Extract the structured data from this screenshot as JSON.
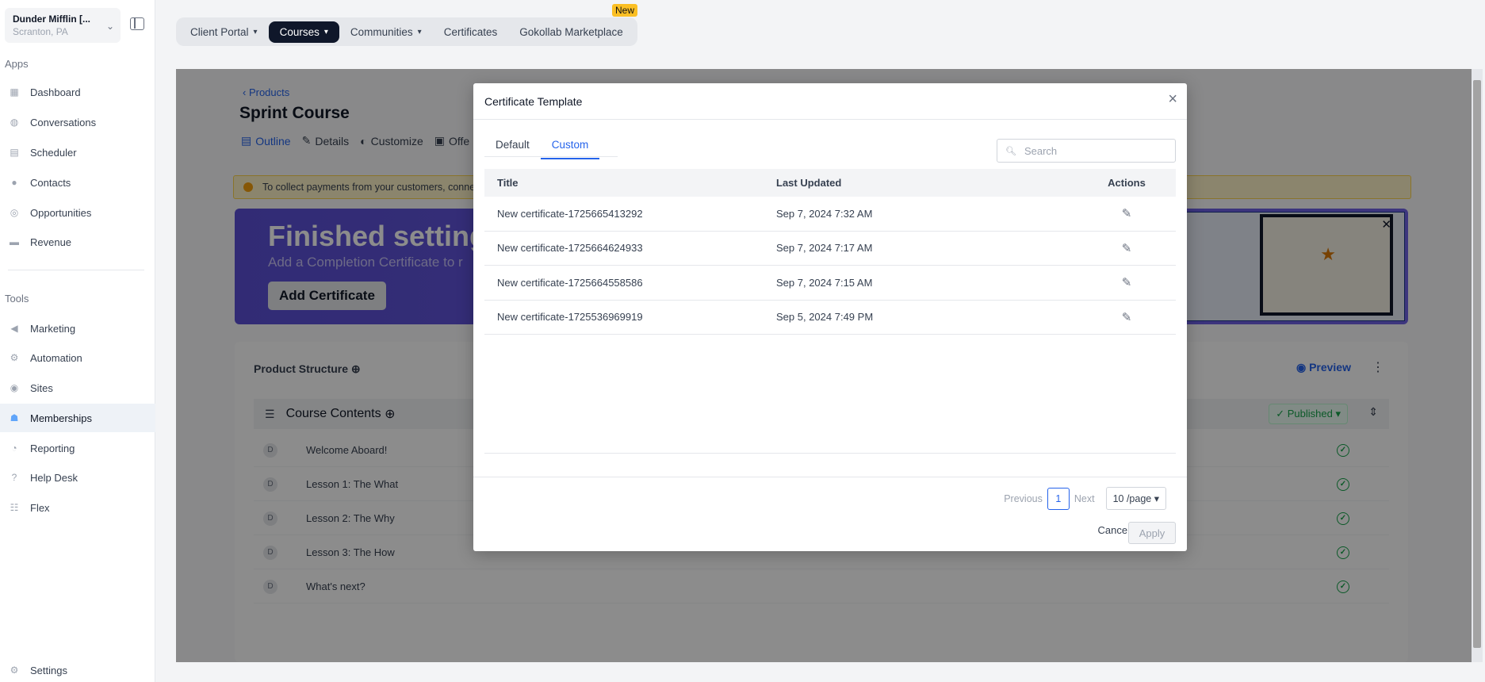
{
  "account": {
    "name": "Dunder Mifflin [...",
    "location": "Scranton, PA"
  },
  "sidebar": {
    "apps_label": "Apps",
    "apps": [
      {
        "label": "Dashboard",
        "icon": "dashboard-icon"
      },
      {
        "label": "Conversations",
        "icon": "chat-icon"
      },
      {
        "label": "Scheduler",
        "icon": "calendar-icon"
      },
      {
        "label": "Contacts",
        "icon": "user-icon"
      },
      {
        "label": "Opportunities",
        "icon": "target-icon"
      },
      {
        "label": "Revenue",
        "icon": "card-icon"
      }
    ],
    "tools_label": "Tools",
    "tools": [
      {
        "label": "Marketing",
        "icon": "megaphone-icon"
      },
      {
        "label": "Automation",
        "icon": "gears-icon"
      },
      {
        "label": "Sites",
        "icon": "globe-icon"
      },
      {
        "label": "Memberships",
        "icon": "members-icon",
        "active": true
      },
      {
        "label": "Reporting",
        "icon": "pie-icon"
      },
      {
        "label": "Help Desk",
        "icon": "help-icon"
      },
      {
        "label": "Flex",
        "icon": "flex-icon"
      }
    ],
    "settings_label": "Settings"
  },
  "topnav": {
    "items": [
      "Client Portal",
      "Courses",
      "Communities",
      "Certificates",
      "Gokollab Marketplace"
    ],
    "new_badge": "New"
  },
  "page": {
    "breadcrumb": "Products",
    "title": "Sprint Course",
    "tabs": [
      "Outline",
      "Details",
      "Customize",
      "Offe"
    ],
    "alert": "To collect payments from your customers, conne",
    "banner_title": "Finished setting",
    "banner_sub": "Add a Completion Certificate to r",
    "banner_button": "Add Certificate",
    "structure_title": "Product Structure",
    "preview": "Preview",
    "course_contents": "Course Contents",
    "published": "Published",
    "lessons": [
      "Welcome Aboard!",
      "Lesson 1: The What",
      "Lesson 2: The Why",
      "Lesson 3: The How",
      "What's next?"
    ]
  },
  "modal": {
    "title": "Certificate Template",
    "tabs": [
      "Default",
      "Custom"
    ],
    "search_placeholder": "Search",
    "columns": [
      "Title",
      "Last Updated",
      "Actions"
    ],
    "rows": [
      {
        "title": "New certificate-1725665413292",
        "updated": "Sep 7, 2024 7:32 AM"
      },
      {
        "title": "New certificate-1725664624933",
        "updated": "Sep 7, 2024 7:17 AM"
      },
      {
        "title": "New certificate-1725664558586",
        "updated": "Sep 7, 2024 7:15 AM"
      },
      {
        "title": "New certificate-1725536969919",
        "updated": "Sep 5, 2024 7:49 PM"
      }
    ],
    "pager": {
      "previous": "Previous",
      "page": "1",
      "next": "Next",
      "per_page": "10 /page"
    },
    "cancel": "Cancel",
    "apply": "Apply"
  }
}
